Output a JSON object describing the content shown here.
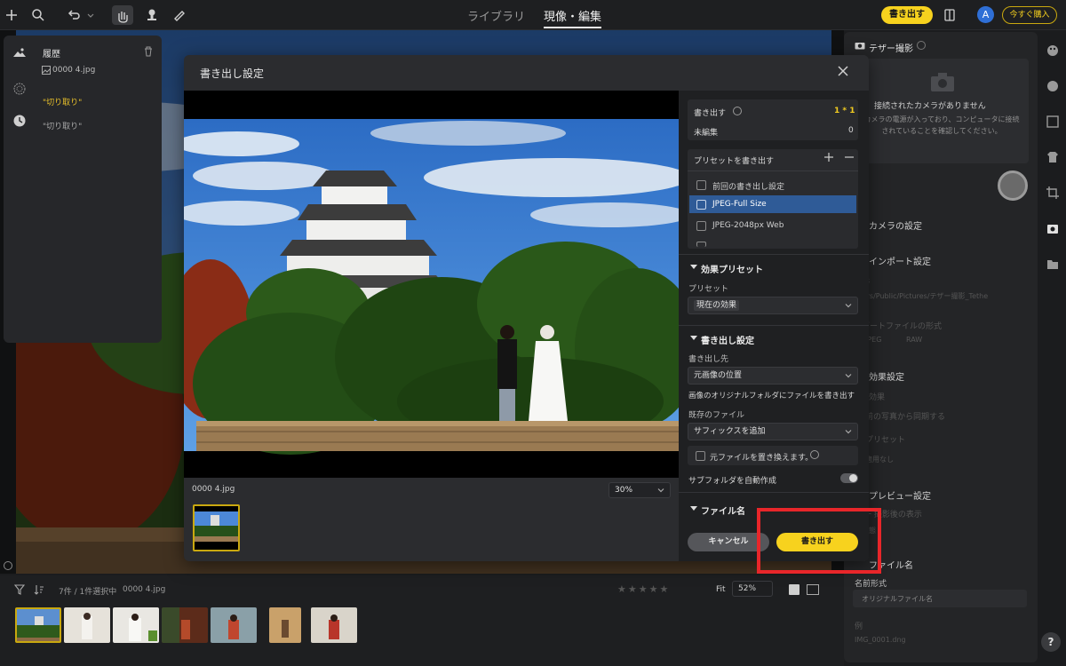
{
  "topbar": {
    "tabs": [
      "ライブラリ",
      "現像・編集"
    ],
    "export_label": "書き出す",
    "avatar_letter": "A",
    "buy_label": "今すぐ購入"
  },
  "history": {
    "title": "履歴",
    "file": "0000 4.jpg",
    "items": [
      "\"切り取り\"",
      "\"切り取り\""
    ]
  },
  "modal": {
    "title": "書き出し設定",
    "filename": "0000 4.jpg",
    "zoom": "30%",
    "export_count_label": "書き出す",
    "export_count_value": "1 * 1",
    "unedited_label": "未編集",
    "unedited_value": "0",
    "preset_section": "プリセットを書き出す",
    "presets": [
      "前回の書き出し設定",
      "JPEG-Full Size",
      "JPEG-2048px Web"
    ],
    "effect_section": "効果プリセット",
    "preset_label": "プリセット",
    "preset_value": "現在の効果",
    "export_section": "書き出し設定",
    "dest_label": "書き出し先",
    "dest_value": "元画像の位置",
    "dest_desc": "画像のオリジナルフォルダにファイルを書き出す",
    "existing_label": "既存のファイル",
    "existing_value": "サフィックスを追加",
    "replace_label": "元ファイルを置き換えます。",
    "subfolder_label": "サブフォルダを自動作成",
    "filename_section": "ファイル名",
    "cancel_label": "キャンセル",
    "export_label": "書き出す"
  },
  "rightpanel": {
    "tether_title": "テザー撮影",
    "no_camera": "接続されたカメラがありません",
    "no_camera_desc": "カメラの電源が入っており、コンピュータに接続されていることを確認してください。",
    "camera_settings": "カメラの設定",
    "import_settings": "インポート設定",
    "dest_short": "先",
    "dest_path": "/Users/Public/Pictures/テザー撮影_Tethe",
    "import_format": "ポートファイルの形式",
    "fmt_jpeg": "JPEG",
    "fmt_raw": "RAW",
    "effect_settings": "効果設定",
    "effect_apply": "効果",
    "sync_label": "前の写真から同期する",
    "preset_label": "プリセット",
    "preset_value": "適用なし",
    "preview_settings": "プレビュー設定",
    "preview_after": "一 撮影後の表示",
    "preview_state": "状態",
    "filename_title": "ファイル名",
    "name_format_label": "名前形式",
    "name_format_value": "オリジナルファイル名",
    "example_label": "例",
    "example_value": "IMG_0001.dng"
  },
  "filmbar": {
    "count": "7件 / 1件選択中",
    "file": "0000 4.jpg",
    "fit": "Fit",
    "zoom": "52%"
  },
  "help": "?"
}
